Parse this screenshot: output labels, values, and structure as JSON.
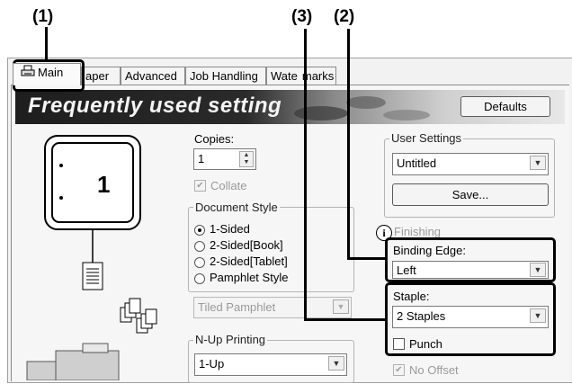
{
  "callouts": {
    "c1": "(1)",
    "c2": "(2)",
    "c3": "(3)"
  },
  "tabs": [
    {
      "label": "Main",
      "icon": "printer-icon"
    },
    {
      "label": "aper"
    },
    {
      "label": "Advanced"
    },
    {
      "label": "Job Handling"
    },
    {
      "label": "Wate"
    },
    {
      "label": "marks"
    }
  ],
  "banner": {
    "title": "Frequently used setting"
  },
  "defaults_button": "Defaults",
  "preview": {
    "page_number": "1"
  },
  "copies": {
    "label": "Copies:",
    "value": "1"
  },
  "collate": {
    "label": "Collate",
    "checked": true
  },
  "document_style": {
    "label": "Document Style",
    "options": [
      "1-Sided",
      "2-Sided[Book]",
      "2-Sided[Tablet]",
      "Pamphlet Style"
    ],
    "selected": "1-Sided",
    "pamphlet_select": "Tiled Pamphlet"
  },
  "nup": {
    "label": "N-Up Printing",
    "value": "1-Up"
  },
  "user_settings": {
    "label": "User Settings",
    "value": "Untitled",
    "save_button": "Save..."
  },
  "finishing": {
    "label": "Finishing",
    "binding_edge_label": "Binding Edge:",
    "binding_edge_value": "Left",
    "staple_label": "Staple:",
    "staple_value": "2 Staples",
    "punch_label": "Punch",
    "offset_label": "No Offset"
  }
}
